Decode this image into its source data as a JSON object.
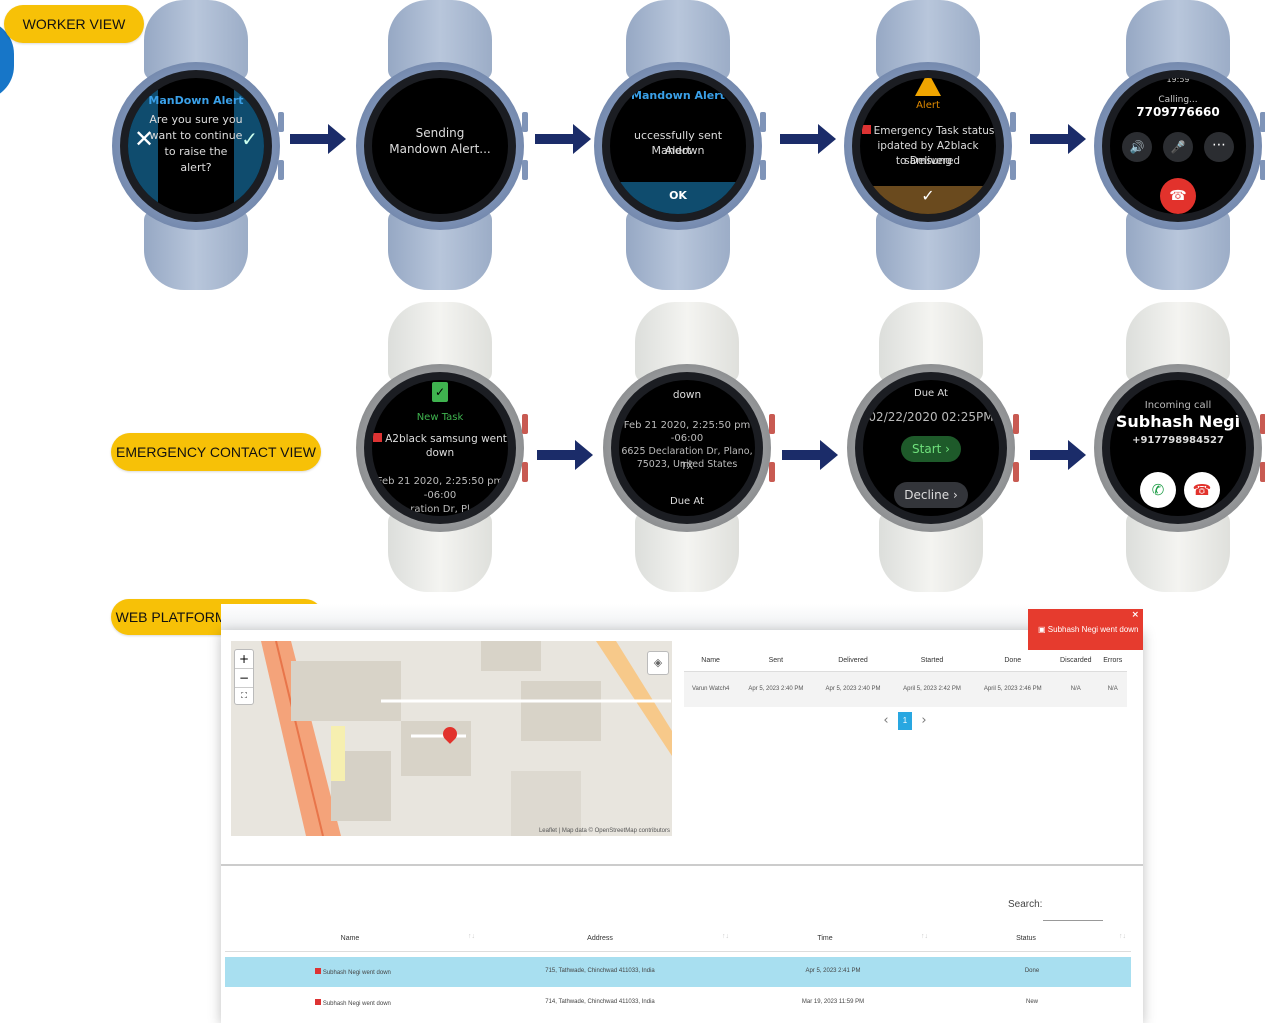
{
  "labels": {
    "worker_view": "WORKER VIEW",
    "emergency_contact_view": "EMERGENCY CONTACT VIEW",
    "web_admin_view": "WEB PLATFORM: ADMIN VIEW"
  },
  "worker_watches": [
    {
      "title": "ManDown Alert",
      "body_line1": "Are you sure you",
      "body_line2": "want to continue",
      "body_line3": "to raise the",
      "body_line4": "alert?"
    },
    {
      "line1": "Sending",
      "line2": "Mandown Alert..."
    },
    {
      "title": "Mandown Alert",
      "line1": "uccessfully sent Mandown",
      "line2": "Alert",
      "ok_label": "OK"
    },
    {
      "alert_label": "Alert",
      "line1": "Emergency Task status",
      "line2": "ipdated by A2black samsung",
      "line3": "to Delivered"
    },
    {
      "time": "19:59",
      "calling": "Calling...",
      "number": "7709776660"
    }
  ],
  "contact_watches": [
    {
      "new_task": "New Task",
      "line1": "A2black samsung went",
      "line2": "down",
      "line3": "Feb 21 2020, 2:25:50 pm",
      "line4": "-06:00",
      "line5": "ration Dr, Pl"
    },
    {
      "line0": "down",
      "line1": "Feb 21 2020, 2:25:50 pm",
      "line2": "-06:00",
      "line3": "6625 Declaration Dr, Plano, TX",
      "line4": "75023, United States",
      "due_at": "Due At"
    },
    {
      "due_at": "Due At",
      "datetime": "02/22/2020 02:25PM",
      "start": "Start",
      "decline": "Decline"
    },
    {
      "incoming": "Incoming call",
      "name": "Subhash Negi",
      "number": "+917798984527"
    }
  ],
  "admin": {
    "notification": "Subhash Negi went down",
    "map_zoom_in": "+",
    "map_zoom_out": "−",
    "map_attribution": "Leaflet | Map data © OpenStreetMap contributors",
    "task_table": {
      "headers": [
        "Name",
        "Sent",
        "Delivered",
        "Started",
        "Done",
        "Discarded",
        "Errors"
      ],
      "row": [
        "Varun Watch4",
        "Apr 5, 2023 2:40 PM",
        "Apr 5, 2023 2:40 PM",
        "April 5, 2023 2:42 PM",
        "April 5, 2023 2:46 PM",
        "N/A",
        "N/A"
      ]
    },
    "pagination": {
      "prev": "‹",
      "page": "1",
      "next": "›"
    },
    "search_label": "Search:",
    "event_table": {
      "headers": [
        "Name",
        "Address",
        "Time",
        "Status"
      ],
      "rows": [
        [
          "Subhash Negi went down",
          "715, Tathwade, Chinchwad 411033, India",
          "Apr 5, 2023 2:41 PM",
          "Done"
        ],
        [
          "Subhash Negi went down",
          "714, Tathwade, Chinchwad 411033, India",
          "Mar 19, 2023 11:59 PM",
          "New"
        ]
      ]
    }
  }
}
